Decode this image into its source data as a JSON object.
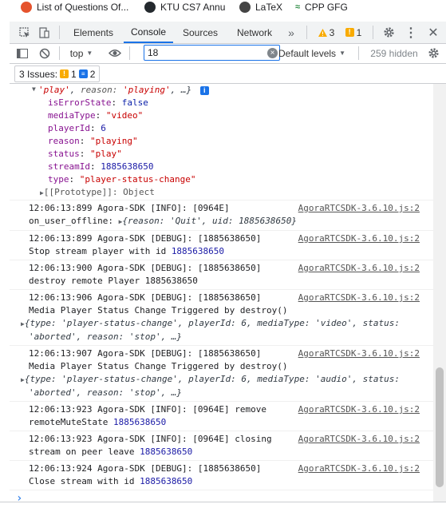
{
  "bookmarks": [
    {
      "label": "List of Questions Of...",
      "color": "#e5532d",
      "icon": "reddit-icon"
    },
    {
      "label": "KTU CS7 Annu",
      "color": "#24292e",
      "icon": "github-icon"
    },
    {
      "label": "LaTeX",
      "color": "#444444",
      "icon": "overleaf-icon"
    },
    {
      "label": "CPP GFG",
      "color": "#2f8d46",
      "icon": "gfg-icon"
    }
  ],
  "tabs": [
    "Elements",
    "Console",
    "Sources",
    "Network"
  ],
  "active_tab": "Console",
  "more_tabs": "»",
  "warnings_count": "3",
  "issues_badge_count": "1",
  "toolbar": {
    "context": "top",
    "filter_value": "18",
    "levels": "Default levels",
    "hidden": "259 hidden"
  },
  "issues": {
    "label": "3 Issues:",
    "warn": "1",
    "info": "2"
  },
  "object": {
    "head_play": "'play'",
    "head_reason_key": "reason:",
    "head_reason_val": "'playing'",
    "head_tail": ", …}",
    "props": [
      {
        "key": "isErrorState",
        "val": "false",
        "type": "kw"
      },
      {
        "key": "mediaType",
        "val": "\"video\"",
        "type": "str"
      },
      {
        "key": "playerId",
        "val": "6",
        "type": "num"
      },
      {
        "key": "reason",
        "val": "\"playing\"",
        "type": "str"
      },
      {
        "key": "status",
        "val": "\"play\"",
        "type": "str"
      },
      {
        "key": "streamId",
        "val": "1885638650",
        "type": "num"
      },
      {
        "key": "type",
        "val": "\"player-status-change\"",
        "type": "str"
      }
    ],
    "prototype": "[[Prototype]]: Object"
  },
  "messages": [
    {
      "line1": "12:06:13:899 Agora-SDK [INFO]: [0964E]",
      "line2_text": "on_user_offline: ",
      "line2_preview": "{reason: 'Quit', uid: 1885638650}",
      "src": "AgoraRTCSDK-3.6.10.js:2"
    },
    {
      "line1": "12:06:13:899 Agora-SDK [DEBUG]: [1885638650]",
      "line2_text": "Stop stream player with id  ",
      "line2_num": "1885638650",
      "src": "AgoraRTCSDK-3.6.10.js:2"
    },
    {
      "line1": "12:06:13:900 Agora-SDK [DEBUG]: [1885638650]",
      "line2_text": "destroy remote Player 1885638650",
      "src": "AgoraRTCSDK-3.6.10.js:2"
    },
    {
      "line1": "12:06:13:906 Agora-SDK [DEBUG]: [1885638650]",
      "line2_text": "Media Player Status Change Triggered by destroy()",
      "obj1": "{type: 'player-status-change', playerId: 6, mediaType: 'video', status:",
      "obj2": "'aborted', reason: 'stop', …}",
      "src": "AgoraRTCSDK-3.6.10.js:2"
    },
    {
      "line1": "12:06:13:907 Agora-SDK [DEBUG]: [1885638650]",
      "line2_text": "Media Player Status Change Triggered by destroy()",
      "obj1": "{type: 'player-status-change', playerId: 6, mediaType: 'audio', status:",
      "obj2": "'aborted', reason: 'stop', …}",
      "src": "AgoraRTCSDK-3.6.10.js:2"
    },
    {
      "line1": "12:06:13:923 Agora-SDK [INFO]: [0964E] remove",
      "line2_text": "remoteMuteState  ",
      "line2_num": "1885638650",
      "src": "AgoraRTCSDK-3.6.10.js:2"
    },
    {
      "line1": "12:06:13:923 Agora-SDK [INFO]: [0964E] closing",
      "line2_text": "stream on peer leave ",
      "line2_num": "1885638650",
      "src": "AgoraRTCSDK-3.6.10.js:2"
    },
    {
      "line1": "12:06:13:924 Agora-SDK [DEBUG]: [1885638650]",
      "line2_text": "Close stream with id ",
      "line2_num": "1885638650",
      "src": "AgoraRTCSDK-3.6.10.js:2"
    }
  ],
  "prompt": "›"
}
